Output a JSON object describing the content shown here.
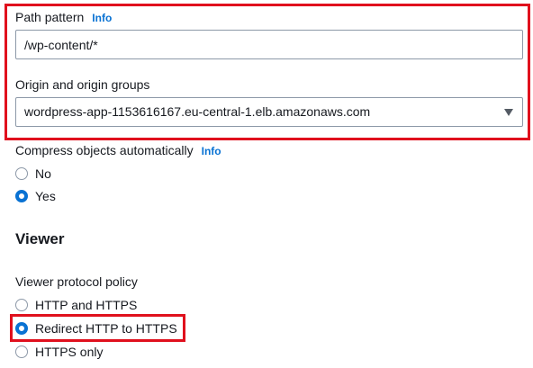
{
  "path_pattern": {
    "label": "Path pattern",
    "info": "Info",
    "value": "/wp-content/*"
  },
  "origin": {
    "label": "Origin and origin groups",
    "selected": "wordpress-app-1153616167.eu-central-1.elb.amazonaws.com"
  },
  "compress": {
    "label": "Compress objects automatically",
    "info": "Info",
    "options": [
      "No",
      "Yes"
    ],
    "selected": "Yes"
  },
  "viewer": {
    "heading": "Viewer",
    "protocol_label": "Viewer protocol policy",
    "options": [
      "HTTP and HTTPS",
      "Redirect HTTP to HTTPS",
      "HTTPS only"
    ],
    "selected": "Redirect HTTP to HTTPS"
  },
  "colors": {
    "highlight": "#e0101d",
    "link": "#0972d3",
    "radio_selected": "#0972d3"
  }
}
